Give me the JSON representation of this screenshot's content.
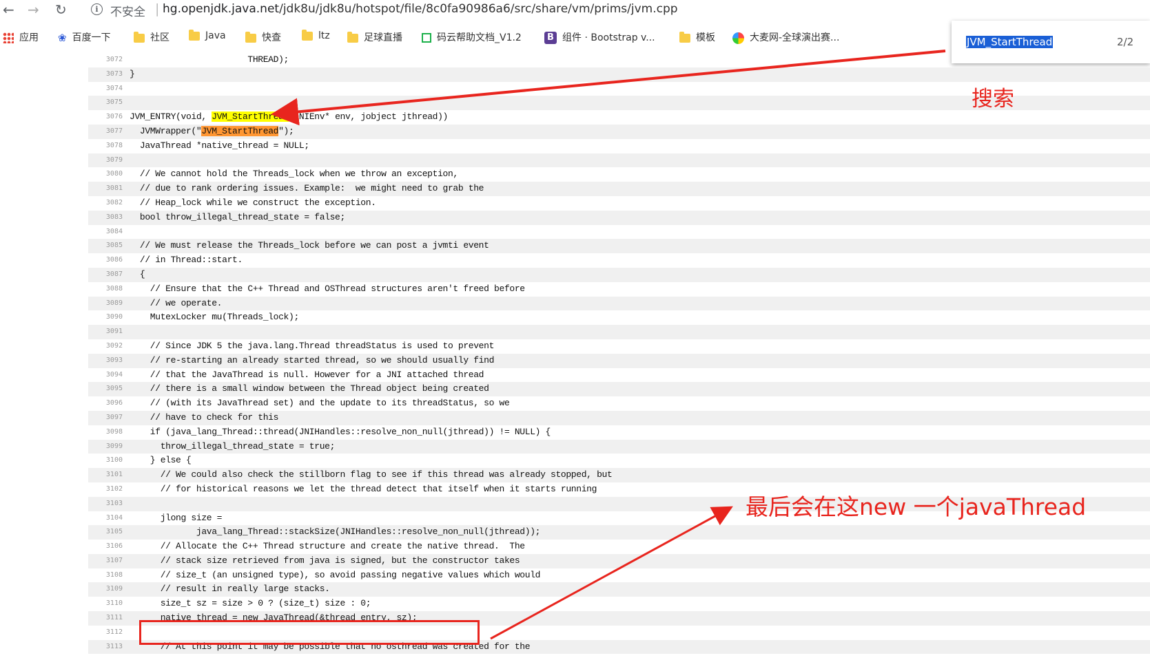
{
  "browser": {
    "back_icon": "arrow-left-icon",
    "forward_icon": "arrow-right-icon",
    "reload_icon": "reload-icon",
    "security_label": "不安全",
    "url_host": "hg.openjdk.java.net",
    "url_path": "/jdk8u/jdk8u/hotspot/file/8c0fa90986a6/src/share/vm/prims/jvm.cpp"
  },
  "bookmarks": [
    {
      "label": "应用",
      "icon": "apps-grid-icon"
    },
    {
      "label": "百度一下",
      "icon": "baidu-paw-icon"
    },
    {
      "label": "社区",
      "icon": "folder-icon"
    },
    {
      "label": "Java",
      "icon": "folder-icon"
    },
    {
      "label": "快查",
      "icon": "folder-icon"
    },
    {
      "label": "ltz",
      "icon": "folder-icon"
    },
    {
      "label": "足球直播",
      "icon": "folder-icon"
    },
    {
      "label": "码云帮助文档_V1.2",
      "icon": "gitee-icon"
    },
    {
      "label": "组件 · Bootstrap v...",
      "icon": "bootstrap-icon"
    },
    {
      "label": "模板",
      "icon": "folder-icon"
    },
    {
      "label": "大麦网-全球演出赛...",
      "icon": "damai-icon"
    }
  ],
  "find_bar": {
    "query": "JVM_StartThread",
    "count": "2/2"
  },
  "code_lines": [
    {
      "n": "3072",
      "text": "                       THREAD);"
    },
    {
      "n": "3073",
      "text": "}"
    },
    {
      "n": "3074",
      "text": ""
    },
    {
      "n": "3075",
      "text": ""
    },
    {
      "n": "3076",
      "pre": "JVM_ENTRY(void, ",
      "hl": "JVM_StartThread",
      "hl_color": "yellow",
      "post": "(JNIEnv* env, jobject jthread))"
    },
    {
      "n": "3077",
      "pre": "  JVMWrapper(\"",
      "hl": "JVM_StartThread",
      "hl_color": "orange",
      "post": "\");"
    },
    {
      "n": "3078",
      "text": "  JavaThread *native_thread = NULL;"
    },
    {
      "n": "3079",
      "text": ""
    },
    {
      "n": "3080",
      "text": "  // We cannot hold the Threads_lock when we throw an exception,"
    },
    {
      "n": "3081",
      "text": "  // due to rank ordering issues. Example:  we might need to grab the"
    },
    {
      "n": "3082",
      "text": "  // Heap_lock while we construct the exception."
    },
    {
      "n": "3083",
      "text": "  bool throw_illegal_thread_state = false;"
    },
    {
      "n": "3084",
      "text": ""
    },
    {
      "n": "3085",
      "text": "  // We must release the Threads_lock before we can post a jvmti event"
    },
    {
      "n": "3086",
      "text": "  // in Thread::start."
    },
    {
      "n": "3087",
      "text": "  {"
    },
    {
      "n": "3088",
      "text": "    // Ensure that the C++ Thread and OSThread structures aren't freed before"
    },
    {
      "n": "3089",
      "text": "    // we operate."
    },
    {
      "n": "3090",
      "text": "    MutexLocker mu(Threads_lock);"
    },
    {
      "n": "3091",
      "text": ""
    },
    {
      "n": "3092",
      "text": "    // Since JDK 5 the java.lang.Thread threadStatus is used to prevent"
    },
    {
      "n": "3093",
      "text": "    // re-starting an already started thread, so we should usually find"
    },
    {
      "n": "3094",
      "text": "    // that the JavaThread is null. However for a JNI attached thread"
    },
    {
      "n": "3095",
      "text": "    // there is a small window between the Thread object being created"
    },
    {
      "n": "3096",
      "text": "    // (with its JavaThread set) and the update to its threadStatus, so we"
    },
    {
      "n": "3097",
      "text": "    // have to check for this"
    },
    {
      "n": "3098",
      "text": "    if (java_lang_Thread::thread(JNIHandles::resolve_non_null(jthread)) != NULL) {"
    },
    {
      "n": "3099",
      "text": "      throw_illegal_thread_state = true;"
    },
    {
      "n": "3100",
      "text": "    } else {"
    },
    {
      "n": "3101",
      "text": "      // We could also check the stillborn flag to see if this thread was already stopped, but"
    },
    {
      "n": "3102",
      "text": "      // for historical reasons we let the thread detect that itself when it starts running"
    },
    {
      "n": "3103",
      "text": ""
    },
    {
      "n": "3104",
      "text": "      jlong size ="
    },
    {
      "n": "3105",
      "text": "             java_lang_Thread::stackSize(JNIHandles::resolve_non_null(jthread));"
    },
    {
      "n": "3106",
      "text": "      // Allocate the C++ Thread structure and create the native thread.  The"
    },
    {
      "n": "3107",
      "text": "      // stack size retrieved from java is signed, but the constructor takes"
    },
    {
      "n": "3108",
      "text": "      // size_t (an unsigned type), so avoid passing negative values which would"
    },
    {
      "n": "3109",
      "text": "      // result in really large stacks."
    },
    {
      "n": "3110",
      "text": "      size_t sz = size > 0 ? (size_t) size : 0;"
    },
    {
      "n": "3111",
      "text": "      native_thread = new JavaThread(&thread_entry, sz);"
    },
    {
      "n": "3112",
      "text": ""
    },
    {
      "n": "3113",
      "text": "      // At this point it may be possible that no osthread was created for the"
    }
  ],
  "annotations": {
    "search_label": "搜索",
    "new_thread_label": "最后会在这new 一个javaThread",
    "color": "#e8251e"
  }
}
